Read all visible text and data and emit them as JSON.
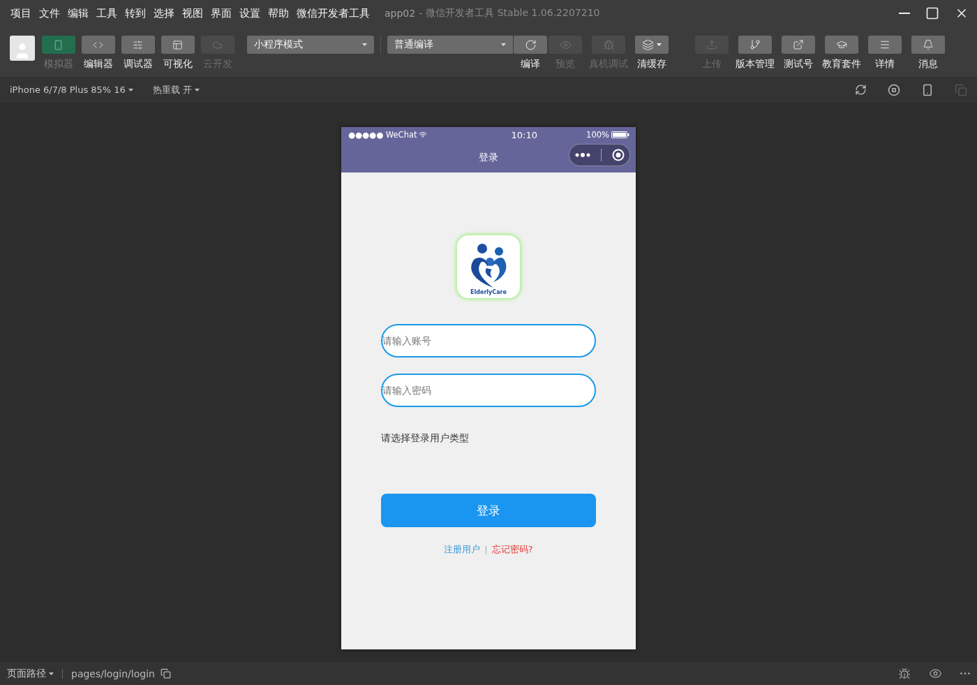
{
  "menu": [
    "项目",
    "文件",
    "编辑",
    "工具",
    "转到",
    "选择",
    "视图",
    "界面",
    "设置",
    "帮助",
    "微信开发者工具"
  ],
  "window": {
    "project": "app02",
    "separator": "-",
    "title": "微信开发者工具 Stable 1.06.2207210"
  },
  "view_toggles": [
    {
      "label": "模拟器",
      "selected": true,
      "disabled": false
    },
    {
      "label": "编辑器",
      "selected": false,
      "disabled": false
    },
    {
      "label": "调试器",
      "selected": false,
      "disabled": false
    },
    {
      "label": "可视化",
      "selected": false,
      "disabled": false
    },
    {
      "label": "云开发",
      "selected": false,
      "disabled": true
    }
  ],
  "mode_select": {
    "value": "小程序模式"
  },
  "compile_select": {
    "value": "普通编译"
  },
  "compile_actions": [
    {
      "label": "编译",
      "disabled": false,
      "menu": false
    },
    {
      "label": "预览",
      "disabled": true,
      "menu": false
    },
    {
      "label": "真机调试",
      "disabled": true,
      "menu": false
    },
    {
      "label": "清缓存",
      "disabled": false,
      "menu": true
    }
  ],
  "project_actions": [
    {
      "label": "上传",
      "disabled": true
    },
    {
      "label": "版本管理",
      "disabled": false
    },
    {
      "label": "测试号",
      "disabled": false
    },
    {
      "label": "教育套件",
      "disabled": false
    },
    {
      "label": "详情",
      "disabled": false
    },
    {
      "label": "消息",
      "disabled": false
    }
  ],
  "sim_bar": {
    "device": "iPhone 6/7/8 Plus 85% 16",
    "hot_reload": "热重载 开"
  },
  "phone": {
    "carrier": "●●●●● WeChat",
    "time": "10:10",
    "battery": "100%",
    "nav_title": "登录",
    "logo_text": "ElderlyCare",
    "fields": [
      {
        "placeholder": "请输入账号"
      },
      {
        "placeholder": "请输入密码"
      }
    ],
    "user_type_label": "请选择登录用户类型",
    "login_button": "登录",
    "register_link": "注册用户",
    "divider": "|",
    "forgot_link": "忘记密码?"
  },
  "status_bar": {
    "path_label": "页面路径",
    "path": "pages/login/login"
  }
}
